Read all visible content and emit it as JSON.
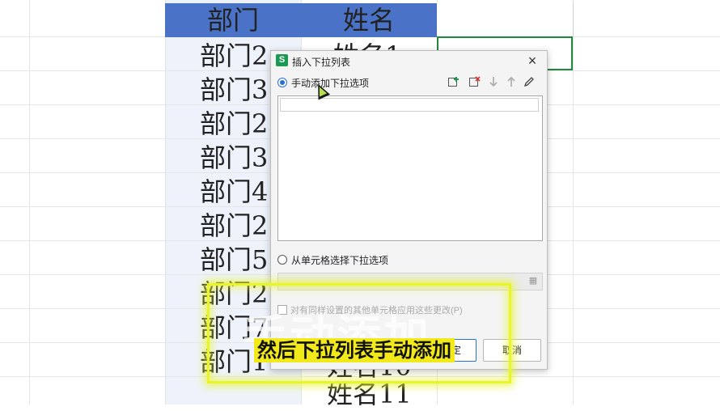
{
  "sheet": {
    "header_dept": "部门",
    "header_name": "姓名",
    "dept_rows": [
      "部门2",
      "部门3",
      "部门2",
      "部门3",
      "部门4",
      "部门2",
      "部门5",
      "部门2",
      "部门7",
      "部门1"
    ],
    "name_rows": [
      "姓名1",
      "姓名10",
      "姓名11"
    ]
  },
  "dialog": {
    "app_icon": "S",
    "title": "插入下拉列表",
    "close": "×",
    "option_manual": "手动添加下拉选项",
    "option_cell": "从单元格选择下拉选项",
    "tools": {
      "add": "add-item-icon",
      "delete": "delete-item-icon",
      "down": "move-down-icon",
      "up": "move-up-icon",
      "edit": "edit-icon"
    },
    "checkbox_label": "对有同样设置的其他单元格应用这些更改(P)",
    "ok": "确定",
    "cancel": "取消"
  },
  "overlay": {
    "ghost": "手动添加",
    "caption": "然后下拉列表手动添加"
  },
  "colors": {
    "header_bg": "#4a72c6",
    "selection": "#1e8a3c",
    "highlight": "#e9f52b"
  }
}
